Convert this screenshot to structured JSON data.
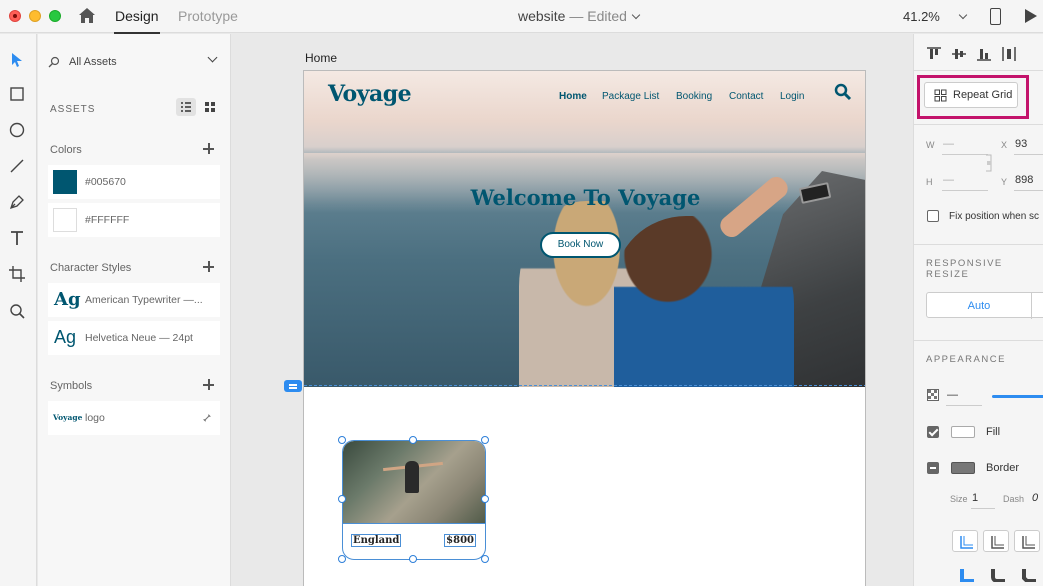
{
  "titlebar": {
    "tabs": [
      {
        "label": "Design"
      },
      {
        "label": "Prototype"
      }
    ],
    "doc_name": "website",
    "doc_sep": " — ",
    "doc_status": "Edited",
    "zoom": "41.2%"
  },
  "assets": {
    "search_label": "All Assets",
    "section_assets": "ASSETS",
    "colors_title": "Colors",
    "colors": [
      {
        "label": "#005670",
        "hex": "#005670"
      },
      {
        "label": "#FFFFFF",
        "hex": "#FFFFFF"
      }
    ],
    "char_styles_title": "Character Styles",
    "char_styles": [
      {
        "glyph": "Ag",
        "label": "American Typewriter —..."
      },
      {
        "glyph": "Ag",
        "label": "Helvetica Neue — 24pt"
      }
    ],
    "symbols_title": "Symbols",
    "symbols": [
      {
        "thumb": "Voyage",
        "label": "logo"
      }
    ]
  },
  "canvas": {
    "artboard_name": "Home",
    "site": {
      "logo": "Voyage",
      "nav": [
        "Home",
        "Package List",
        "Booking",
        "Contact",
        "Login"
      ],
      "hero_title": "Welcome To Voyage",
      "cta": "Book Now",
      "card": {
        "name": "England",
        "price": "$800"
      }
    }
  },
  "props": {
    "repeat_grid": "Repeat Grid",
    "w_label": "W",
    "w_value": "—",
    "h_label": "H",
    "h_value": "—",
    "x_label": "X",
    "x_value": "93",
    "y_label": "Y",
    "y_value": "898",
    "fix_position": "Fix position when sc",
    "responsive_resize": "RESPONSIVE RESIZE",
    "auto": "Auto",
    "appearance": "APPEARANCE",
    "opacity_value": "—",
    "fill": "Fill",
    "border": "Border",
    "size_label": "Size",
    "size_value": "1",
    "dash_label": "Dash",
    "dash_value": "0"
  },
  "colors": {
    "brand": "#005670",
    "selection": "#2d8cf0",
    "highlight": "#c3136b"
  }
}
